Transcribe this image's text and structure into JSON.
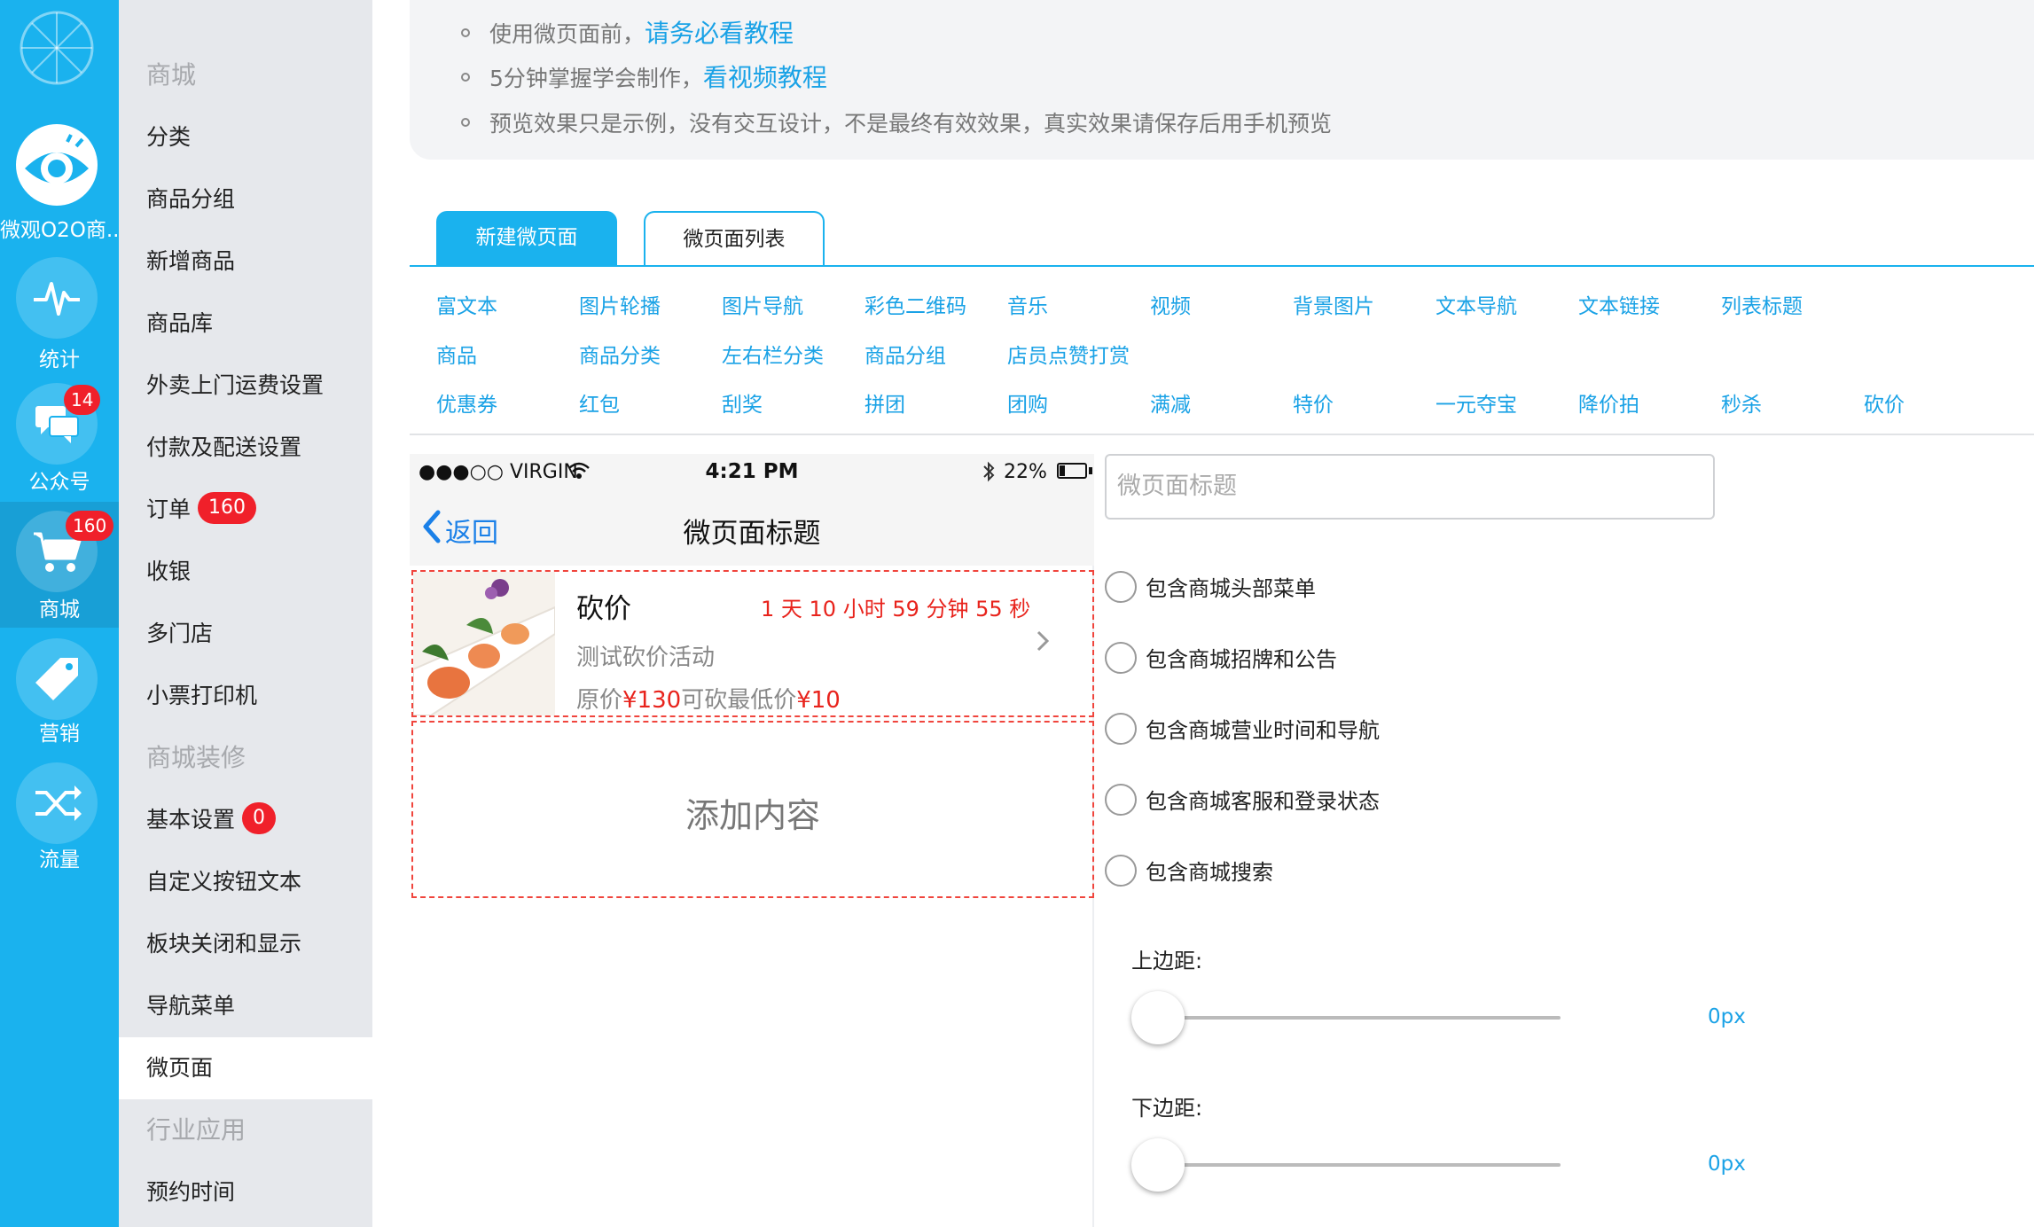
{
  "rail": {
    "app_label": "微观O2O商..",
    "items": [
      {
        "label": "统计",
        "icon": "pulse-icon"
      },
      {
        "label": "公众号",
        "icon": "chat-bubbles-icon",
        "badge": "14"
      },
      {
        "label": "商城",
        "icon": "cart-icon",
        "badge": "160"
      },
      {
        "label": "营销",
        "icon": "tag-icon"
      },
      {
        "label": "流量",
        "icon": "shuffle-icon"
      }
    ]
  },
  "menu": {
    "sections": [
      {
        "title": "商城",
        "items": [
          "分类",
          "商品分组",
          "新增商品",
          "商品库",
          "外卖上门运费设置",
          "付款及配送设置",
          "订单",
          "收银",
          "多门店",
          "小票打印机"
        ]
      },
      {
        "title": "商城装修",
        "items": [
          "基本设置",
          "自定义按钮文本",
          "板块关闭和显示",
          "导航菜单",
          "微页面"
        ]
      },
      {
        "title": "行业应用",
        "items": [
          "预约时间"
        ]
      }
    ],
    "order_badge": "160",
    "basic_badge": "0",
    "active": "微页面"
  },
  "notice": {
    "line1_text": "使用微页面前，",
    "line1_link": "请务必看教程",
    "line2_text": "5分钟掌握学会制作，",
    "line2_link": "看视频教程",
    "line3_text": "预览效果只是示例，没有交互设计，不是最终有效效果，真实效果请保存后用手机预览"
  },
  "tabs": {
    "new_page": "新建微页面",
    "page_list": "微页面列表"
  },
  "components": [
    [
      "富文本",
      "图片轮播",
      "图片导航",
      "彩色二维码",
      "音乐",
      "视频",
      "背景图片",
      "文本导航",
      "文本链接",
      "列表标题"
    ],
    [
      "商品",
      "商品分类",
      "左右栏分类",
      "商品分组",
      "店员点赞打赏"
    ],
    [
      "优惠券",
      "红包",
      "刮奖",
      "拼团",
      "团购",
      "满减",
      "特价",
      "一元夺宝",
      "降价拍",
      "秒杀",
      "砍价"
    ]
  ],
  "phone": {
    "carrier": "●●●○○ VIRGIN",
    "time": "4:21 PM",
    "battery": "22%",
    "battery_level": 0.22,
    "back": "返回",
    "title": "微页面标题",
    "card": {
      "name": "砍价",
      "countdown": "1 天 10 小时 59 分钟 55 秒",
      "desc": "测试砍价活动",
      "price_prefix": "原价",
      "price_original": "¥130",
      "price_mid": "可砍最低价",
      "price_min": "¥10"
    },
    "add_content": "添加内容"
  },
  "settings": {
    "title_placeholder": "微页面标题",
    "options": [
      "包含商城头部菜单",
      "包含商城招牌和公告",
      "包含商城营业时间和导航",
      "包含商城客服和登录状态",
      "包含商城搜索"
    ],
    "top_margin_label": "上边距:",
    "top_margin_value": "0px",
    "bottom_margin_label": "下边距:",
    "bottom_margin_value": "0px"
  },
  "colors": {
    "brand": "#1ab2ee",
    "link": "#1aa2e6",
    "badge": "#f0202a",
    "price": "#e8231c"
  }
}
